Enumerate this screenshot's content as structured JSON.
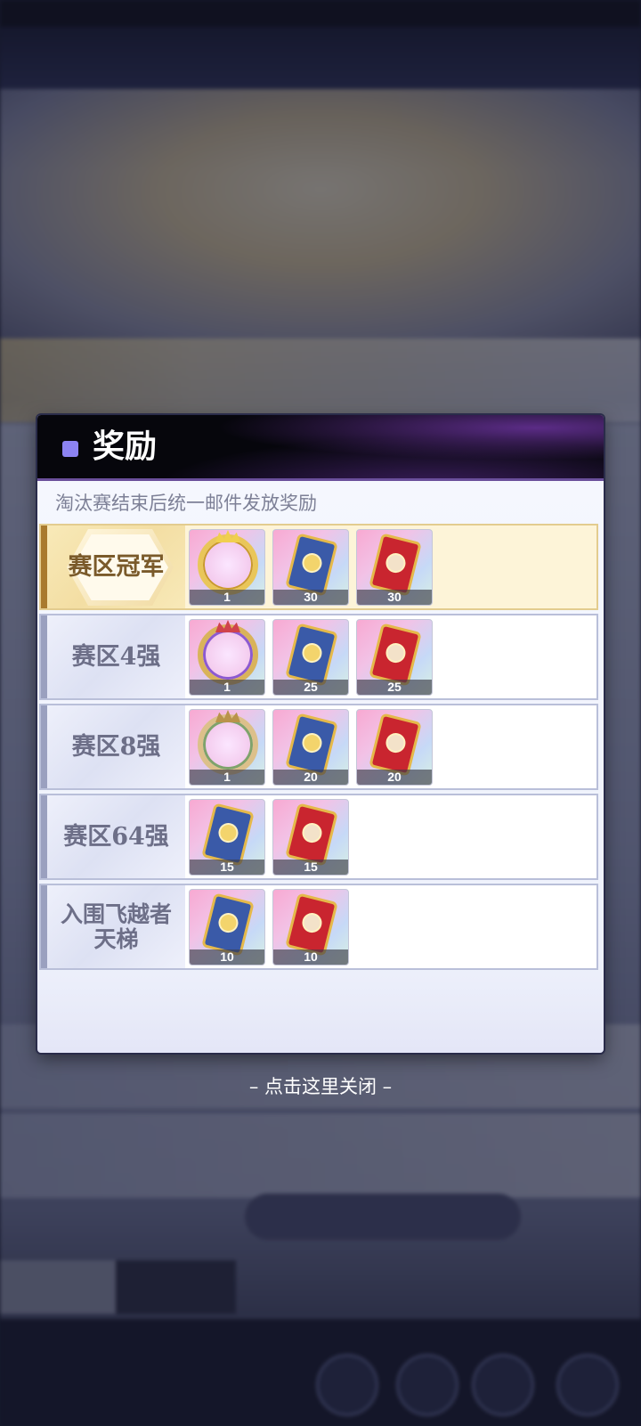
{
  "modal": {
    "title": "奖励",
    "notice": "淘汰赛结束后统一邮件发放奖励",
    "rows": [
      {
        "label": "赛区冠军",
        "highlight": true,
        "items": [
          {
            "kind": "avatar-frame",
            "style": "gold",
            "count": "1"
          },
          {
            "kind": "card",
            "color": "blue",
            "count": "30"
          },
          {
            "kind": "card",
            "color": "red",
            "count": "30"
          }
        ]
      },
      {
        "label": "赛区4强",
        "items": [
          {
            "kind": "avatar-frame",
            "style": "purple",
            "count": "1"
          },
          {
            "kind": "card",
            "color": "blue",
            "count": "25"
          },
          {
            "kind": "card",
            "color": "red",
            "count": "25"
          }
        ]
      },
      {
        "label": "赛区8强",
        "items": [
          {
            "kind": "avatar-frame",
            "style": "leaf",
            "count": "1"
          },
          {
            "kind": "card",
            "color": "blue",
            "count": "20"
          },
          {
            "kind": "card",
            "color": "red",
            "count": "20"
          }
        ]
      },
      {
        "label": "赛区64强",
        "items": [
          {
            "kind": "card",
            "color": "blue",
            "count": "15"
          },
          {
            "kind": "card",
            "color": "red",
            "count": "15"
          }
        ]
      },
      {
        "label": "入围飞越者天梯",
        "items": [
          {
            "kind": "card",
            "color": "blue",
            "count": "10"
          },
          {
            "kind": "card",
            "color": "red",
            "count": "10"
          }
        ]
      }
    ]
  },
  "close_hint": "– 点击这里关闭 –",
  "colors": {
    "header_bg": "#06060c",
    "header_accent": "#8c83f2",
    "champion_bg": "#fdf4d8",
    "champion_accent": "#a97a2e",
    "row_accent": "#9aa0bf"
  }
}
